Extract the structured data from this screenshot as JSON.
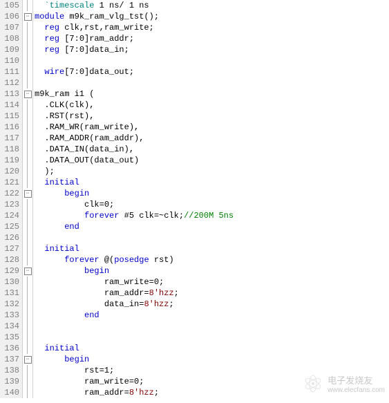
{
  "watermark": {
    "cn": "电子发烧友",
    "url": "www.elecfans.com"
  },
  "lines": [
    {
      "n": "105",
      "fold": "|",
      "seg": [
        [
          "norm",
          "  "
        ],
        [
          "sys",
          "`timescale"
        ],
        [
          "norm",
          " 1 ns/ 1 ns"
        ]
      ]
    },
    {
      "n": "106",
      "fold": "box",
      "seg": [
        [
          "kw",
          "module"
        ],
        [
          "norm",
          " m9k_ram_vlg_tst();"
        ]
      ]
    },
    {
      "n": "107",
      "fold": "|",
      "seg": [
        [
          "norm",
          "  "
        ],
        [
          "kw",
          "reg"
        ],
        [
          "norm",
          " clk,rst,ram_write;"
        ]
      ]
    },
    {
      "n": "108",
      "fold": "|",
      "seg": [
        [
          "norm",
          "  "
        ],
        [
          "kw",
          "reg"
        ],
        [
          "norm",
          " [7:0]ram_addr;"
        ]
      ]
    },
    {
      "n": "109",
      "fold": "|",
      "seg": [
        [
          "norm",
          "  "
        ],
        [
          "kw",
          "reg"
        ],
        [
          "norm",
          " [7:0]data_in;"
        ]
      ]
    },
    {
      "n": "110",
      "fold": "|",
      "seg": [
        [
          "norm",
          ""
        ]
      ]
    },
    {
      "n": "111",
      "fold": "|",
      "seg": [
        [
          "norm",
          "  "
        ],
        [
          "kw",
          "wire"
        ],
        [
          "norm",
          "[7:0]data_out;"
        ]
      ]
    },
    {
      "n": "112",
      "fold": "|",
      "seg": [
        [
          "norm",
          ""
        ]
      ]
    },
    {
      "n": "113",
      "fold": "box",
      "seg": [
        [
          "norm",
          "m9k_ram i1 ("
        ]
      ]
    },
    {
      "n": "114",
      "fold": "|",
      "seg": [
        [
          "norm",
          "  .CLK(clk),"
        ]
      ]
    },
    {
      "n": "115",
      "fold": "|",
      "seg": [
        [
          "norm",
          "  .RST(rst),"
        ]
      ]
    },
    {
      "n": "116",
      "fold": "|",
      "seg": [
        [
          "norm",
          "  .RAM_WR(ram_write),"
        ]
      ]
    },
    {
      "n": "117",
      "fold": "|",
      "seg": [
        [
          "norm",
          "  .RAM_ADDR(ram_addr),"
        ]
      ]
    },
    {
      "n": "118",
      "fold": "|",
      "seg": [
        [
          "norm",
          "  .DATA_IN(data_in),"
        ]
      ]
    },
    {
      "n": "119",
      "fold": "|",
      "seg": [
        [
          "norm",
          "  .DATA_OUT(data_out)"
        ]
      ]
    },
    {
      "n": "120",
      "fold": "|",
      "seg": [
        [
          "norm",
          "  );"
        ]
      ]
    },
    {
      "n": "121",
      "fold": "|",
      "seg": [
        [
          "norm",
          "  "
        ],
        [
          "kw",
          "initial"
        ]
      ]
    },
    {
      "n": "122",
      "fold": "box",
      "seg": [
        [
          "norm",
          "      "
        ],
        [
          "kw",
          "begin"
        ]
      ]
    },
    {
      "n": "123",
      "fold": "|",
      "seg": [
        [
          "norm",
          "          clk=0;"
        ]
      ]
    },
    {
      "n": "124",
      "fold": "|",
      "seg": [
        [
          "norm",
          "          "
        ],
        [
          "kw",
          "forever"
        ],
        [
          "norm",
          " #5 clk=~clk;"
        ],
        [
          "cmt",
          "//200M 5ns"
        ]
      ]
    },
    {
      "n": "125",
      "fold": "|",
      "seg": [
        [
          "norm",
          "      "
        ],
        [
          "kw",
          "end"
        ]
      ]
    },
    {
      "n": "126",
      "fold": "|",
      "seg": [
        [
          "norm",
          ""
        ]
      ]
    },
    {
      "n": "127",
      "fold": "|",
      "seg": [
        [
          "norm",
          "  "
        ],
        [
          "kw",
          "initial"
        ]
      ]
    },
    {
      "n": "128",
      "fold": "|",
      "seg": [
        [
          "norm",
          "      "
        ],
        [
          "kw",
          "forever"
        ],
        [
          "norm",
          " @("
        ],
        [
          "kw",
          "posedge"
        ],
        [
          "norm",
          " rst)"
        ]
      ]
    },
    {
      "n": "129",
      "fold": "box",
      "seg": [
        [
          "norm",
          "          "
        ],
        [
          "kw",
          "begin"
        ]
      ]
    },
    {
      "n": "130",
      "fold": "|",
      "seg": [
        [
          "norm",
          "              ram_write=0;"
        ]
      ]
    },
    {
      "n": "131",
      "fold": "|",
      "seg": [
        [
          "norm",
          "              ram_addr="
        ],
        [
          "str",
          "8'hzz"
        ],
        [
          "norm",
          ";"
        ]
      ]
    },
    {
      "n": "132",
      "fold": "|",
      "seg": [
        [
          "norm",
          "              data_in="
        ],
        [
          "str",
          "8'hzz"
        ],
        [
          "norm",
          ";"
        ]
      ]
    },
    {
      "n": "133",
      "fold": "|",
      "seg": [
        [
          "norm",
          "          "
        ],
        [
          "kw",
          "end"
        ]
      ]
    },
    {
      "n": "134",
      "fold": "|",
      "seg": [
        [
          "norm",
          ""
        ]
      ]
    },
    {
      "n": "135",
      "fold": "|",
      "seg": [
        [
          "norm",
          ""
        ]
      ]
    },
    {
      "n": "136",
      "fold": "|",
      "seg": [
        [
          "norm",
          "  "
        ],
        [
          "kw",
          "initial"
        ]
      ]
    },
    {
      "n": "137",
      "fold": "box",
      "seg": [
        [
          "norm",
          "      "
        ],
        [
          "kw",
          "begin"
        ]
      ]
    },
    {
      "n": "138",
      "fold": "|",
      "seg": [
        [
          "norm",
          "          rst=1;"
        ]
      ]
    },
    {
      "n": "139",
      "fold": "|",
      "seg": [
        [
          "norm",
          "          ram_write=0;"
        ]
      ]
    },
    {
      "n": "140",
      "fold": "|",
      "seg": [
        [
          "norm",
          "          ram_addr="
        ],
        [
          "str",
          "8'hzz"
        ],
        [
          "norm",
          ";"
        ]
      ]
    }
  ]
}
